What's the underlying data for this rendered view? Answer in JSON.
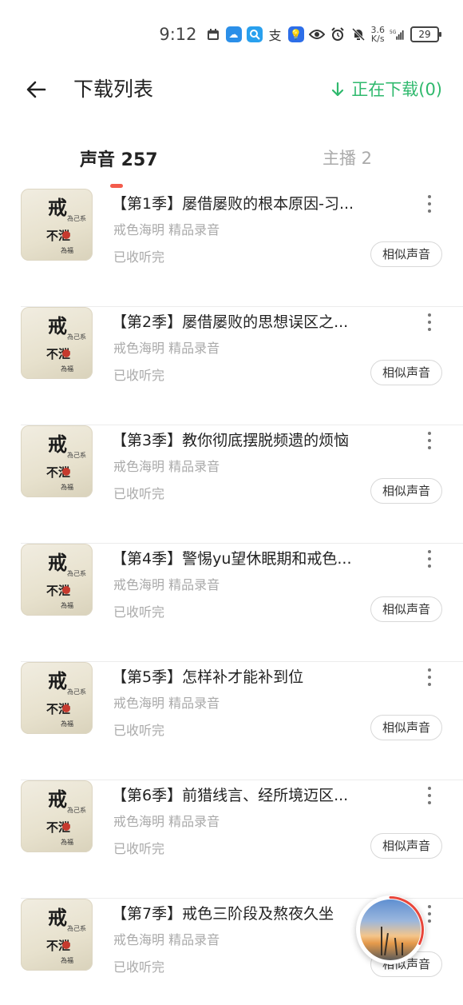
{
  "status_bar": {
    "time": "9:12",
    "speed_value": "3.6",
    "speed_unit": "K/s",
    "battery": "29"
  },
  "header": {
    "title": "下载列表",
    "downloading_label": "正在下载(0)",
    "accent_color": "#2fb96d"
  },
  "tabs": {
    "sound_label": "声音 257",
    "host_label": "主播 2",
    "indicator_color": "#f35b4c"
  },
  "items": [
    {
      "title": "【第1季】屡借屡败的根本原因-习...",
      "subtitle": "戒色海明 精品录音",
      "status": "已收听完",
      "similar_label": "相似声音"
    },
    {
      "title": "【第2季】屡借屡败的思想误区之...",
      "subtitle": "戒色海明 精品录音",
      "status": "已收听完",
      "similar_label": "相似声音"
    },
    {
      "title": "【第3季】教你彻底摆脱频遗的烦恼",
      "subtitle": "戒色海明 精品录音",
      "status": "已收听完",
      "similar_label": "相似声音"
    },
    {
      "title": "【第4季】警惕yu望休眠期和戒色...",
      "subtitle": "戒色海明 精品录音",
      "status": "已收听完",
      "similar_label": "相似声音"
    },
    {
      "title": "【第5季】怎样补才能补到位",
      "subtitle": "戒色海明 精品录音",
      "status": "已收听完",
      "similar_label": "相似声音"
    },
    {
      "title": "【第6季】前猎线言、经所境迈区...",
      "subtitle": "戒色海明 精品录音",
      "status": "已收听完",
      "similar_label": "相似声音"
    },
    {
      "title": "【第7季】戒色三阶段及熬夜久坐",
      "subtitle": "戒色海明 精品录音",
      "status": "已收听完",
      "similar_label": "相似声音"
    }
  ],
  "cover_art": {
    "char_main": "戒",
    "char_small": "為己系",
    "char_mid": "不泄",
    "char_bottom": "為福"
  },
  "player": {
    "progress": 0.32
  }
}
